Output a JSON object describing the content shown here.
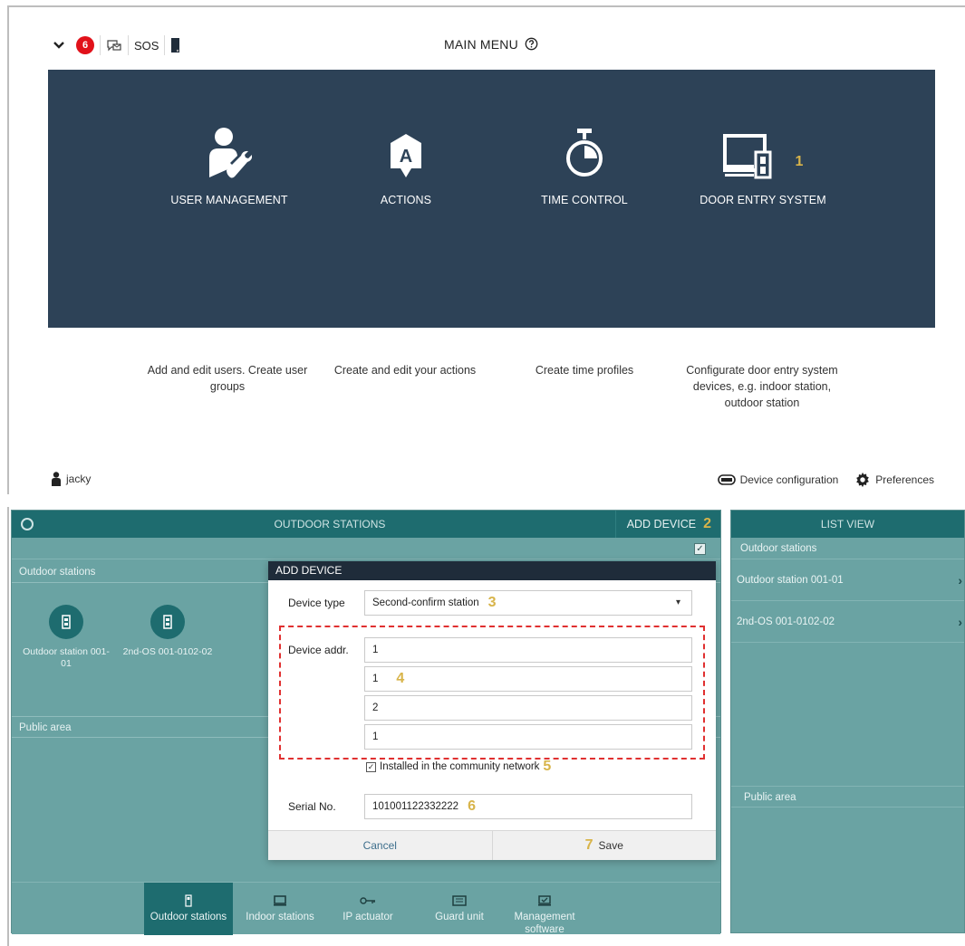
{
  "top": {
    "badge_count": "6",
    "sos": "SOS",
    "title": "MAIN MENU",
    "tiles": [
      {
        "label": "USER MANAGEMENT",
        "desc": "Add and edit users. Create user groups"
      },
      {
        "label": "ACTIONS",
        "desc": "Create and edit your actions"
      },
      {
        "label": "TIME CONTROL",
        "desc": "Create time profiles"
      },
      {
        "label": "DOOR ENTRY SYSTEM",
        "desc": "Configurate door entry system devices, e.g. indoor station, outdoor station"
      }
    ],
    "user": "jacky",
    "device_config": "Device configuration",
    "preferences": "Preferences"
  },
  "callouts": [
    "1",
    "2",
    "3",
    "4",
    "5",
    "6",
    "7"
  ],
  "app": {
    "header_title": "OUTDOOR STATIONS",
    "add_device": "ADD DEVICE",
    "section_outdoor": "Outdoor stations",
    "section_public": "Public area",
    "stations": [
      {
        "label": "Outdoor station 001-01"
      },
      {
        "label": "2nd-OS 001-0102-02"
      }
    ],
    "nav": [
      {
        "label": "Outdoor stations"
      },
      {
        "label": "Indoor stations"
      },
      {
        "label": "IP actuator"
      },
      {
        "label": "Guard unit"
      },
      {
        "label": "Management software"
      }
    ]
  },
  "listview": {
    "title": "LIST VIEW",
    "section_outdoor": "Outdoor stations",
    "items": [
      "Outdoor station 001-01",
      "2nd-OS 001-0102-02"
    ],
    "section_public": "Public area"
  },
  "dialog": {
    "title": "ADD DEVICE",
    "device_type_label": "Device type",
    "device_type_value": "Second-confirm station",
    "device_addr_label": "Device addr.",
    "addr": [
      "1",
      "1",
      "2",
      "1"
    ],
    "community_label": "Installed in the community network",
    "serial_label": "Serial No.",
    "serial_value": "101001122332222",
    "cancel": "Cancel",
    "save": "Save"
  },
  "colors": {
    "hero": "#2d4257",
    "teal_dark": "#1e6c6f",
    "teal": "#6aa3a3",
    "callout": "#d8b44a",
    "badge": "#e1111a"
  }
}
